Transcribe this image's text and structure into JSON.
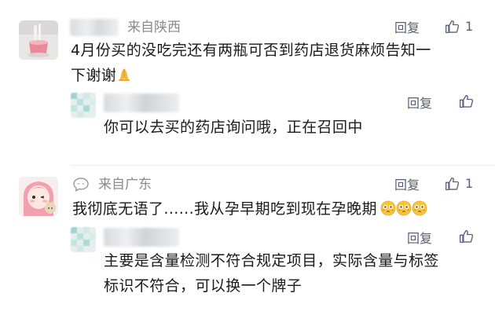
{
  "comments": [
    {
      "location": "来自陕西",
      "reply_label": "回复",
      "like_count": "1",
      "content_line1": "4月份买的没吃完还有两瓶可否到药店退货麻烦告知一",
      "content_line2": "下谢谢",
      "content_emoji": "folded-hands",
      "reply": {
        "reply_label": "回复",
        "content": "你可以去买的药店询问哦，正在召回中"
      }
    },
    {
      "location": "来自广东",
      "reply_label": "回复",
      "like_count": "1",
      "content": "我彻底无语了......我从孕早期吃到现在孕晚期",
      "content_emoji": "flushed-face",
      "reply": {
        "reply_label": "回复",
        "content_line1": "主要是含量检测不符合规定项目，实际含量与标签",
        "content_line2": "标识不符合，可以换一个牌子"
      }
    }
  ],
  "colors": {
    "accent": "#56607a",
    "location": "#8a8a8a",
    "text": "#1a1a1a"
  }
}
